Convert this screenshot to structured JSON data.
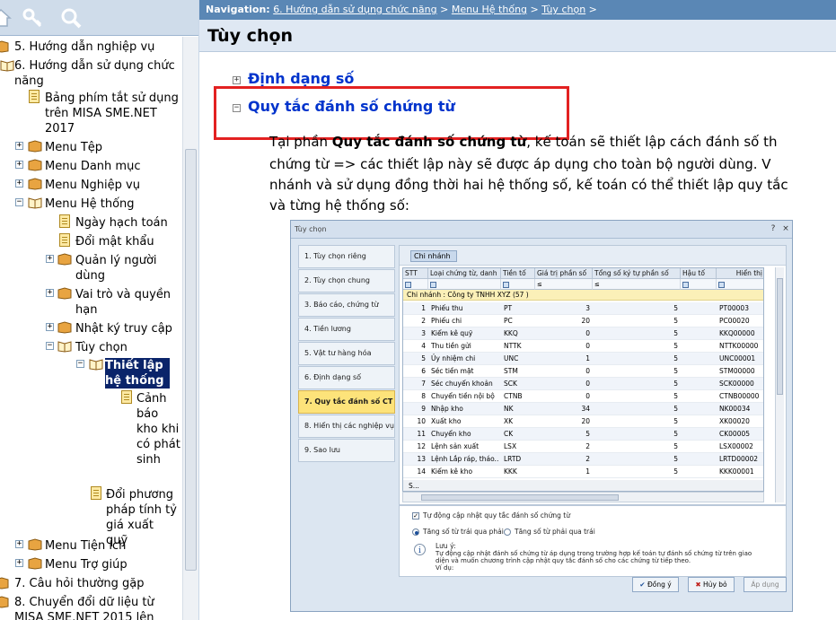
{
  "tree": {
    "items": [
      {
        "label": "5. Hướng dẫn nghiệp vụ"
      },
      {
        "label": "6. Hướng dẫn sử dụng chức năng"
      },
      {
        "label": "Bảng phím tắt sử dụng trên MISA SME.NET 2017"
      },
      {
        "label": "Menu Tệp"
      },
      {
        "label": "Menu Danh mục"
      },
      {
        "label": "Menu Nghiệp vụ"
      },
      {
        "label": "Menu Hệ thống"
      },
      {
        "label": "Ngày hạch toán"
      },
      {
        "label": "Đổi mật khẩu"
      },
      {
        "label": "Quản lý người dùng"
      },
      {
        "label": "Vai trò và quyền hạn"
      },
      {
        "label": "Nhật ký truy cập"
      },
      {
        "label": "Tùy chọn"
      },
      {
        "label": "Thiết lập hệ thống"
      },
      {
        "label": "Cảnh báo kho khi có phát sinh"
      },
      {
        "label": "Đổi phương pháp tính tỷ giá xuất quỹ"
      },
      {
        "label": "Menu Tiện ích"
      },
      {
        "label": "Menu Trợ giúp"
      },
      {
        "label": "7. Câu hỏi thường gặp"
      },
      {
        "label": "8. Chuyển đổi dữ liệu từ MISA SME.NET 2015 lên MISA"
      }
    ]
  },
  "nav": {
    "prefix": "Navigation:",
    "crumb1": "6. Hướng dẫn sử dụng chức năng",
    "sep1": " > ",
    "crumb2": "Menu Hệ thống",
    "sep2": " > ",
    "crumb3": "Tùy chọn",
    "sep3": " >"
  },
  "page": {
    "title": "Tùy chọn",
    "section1": "Định dạng số",
    "section2": "Quy tắc đánh số chứng từ",
    "para_line1_a": "Tại phần ",
    "para_line1_b": "Quy tắc đánh số chứng từ",
    "para_line1_c": ", kế toán sẽ thiết lập cách đánh số th",
    "para_line2": "chứng từ => các thiết lập này sẽ được áp dụng cho toàn bộ người dùng. V",
    "para_line3": "nhánh và sử dụng đồng thời hai hệ thống số, kế toán có thể thiết lập quy tắc",
    "para_line4": "và từng hệ thống số:"
  },
  "dialog": {
    "title": "Tùy chọn",
    "help": "?",
    "close": "×",
    "menu": [
      "1. Tùy chọn riêng",
      "2. Tùy chọn chung",
      "3. Báo cáo, chứng từ",
      "4. Tiền lương",
      "5. Vật tư hàng hóa",
      "6. Định dạng số",
      "7. Quy tắc đánh số CT",
      "8. Hiển thị các nghiệp vụ",
      "9. Sao lưu"
    ],
    "group_chip": "Chi nhánh",
    "columns": [
      "STT",
      "Loại chứng từ, danh",
      "Tiền tố",
      "Giá trị phần số",
      "Tổng số ký tự phần số",
      "Hậu tố",
      "Hiển thị"
    ],
    "filter_ops": [
      "≤",
      "≤"
    ],
    "group_row": "Chi nhánh : Công ty TNHH XYZ (57 )",
    "rows": [
      [
        "1",
        "Phiếu thu",
        "PT",
        "3",
        "5",
        "PT00003"
      ],
      [
        "2",
        "Phiếu chi",
        "PC",
        "20",
        "5",
        "PC00020"
      ],
      [
        "3",
        "Kiểm kê quỹ",
        "KKQ",
        "0",
        "5",
        "KKQ00000"
      ],
      [
        "4",
        "Thu tiền gửi",
        "NTTK",
        "0",
        "5",
        "NTTK00000"
      ],
      [
        "5",
        "Ủy nhiệm chi",
        "UNC",
        "1",
        "5",
        "UNC00001"
      ],
      [
        "6",
        "Séc tiền mặt",
        "STM",
        "0",
        "5",
        "STM00000"
      ],
      [
        "7",
        "Séc chuyển khoản",
        "SCK",
        "0",
        "5",
        "SCK00000"
      ],
      [
        "8",
        "Chuyển tiền nội bộ",
        "CTNB",
        "0",
        "5",
        "CTNB00000"
      ],
      [
        "9",
        "Nhập kho",
        "NK",
        "34",
        "5",
        "NK00034"
      ],
      [
        "10",
        "Xuất kho",
        "XK",
        "20",
        "5",
        "XK00020"
      ],
      [
        "11",
        "Chuyển kho",
        "CK",
        "5",
        "5",
        "CK00005"
      ],
      [
        "12",
        "Lệnh sản xuất",
        "LSX",
        "2",
        "5",
        "LSX00002"
      ],
      [
        "13",
        "Lệnh Lắp ráp, tháo...",
        "LRTD",
        "2",
        "5",
        "LRTD00002"
      ],
      [
        "14",
        "Kiểm kê kho",
        "KKK",
        "1",
        "5",
        "KKK00001"
      ]
    ],
    "footer_row": "S...",
    "auto_update": "Tự động cập nhật quy tắc đánh số chứng từ",
    "radio1": "Tăng số từ trái qua phải",
    "radio2": "Tăng số từ phải qua trái",
    "note_title": "Lưu ý:",
    "note_line1": "Tự động cập nhật đánh số chứng từ áp dụng trong trường hợp kế toán tự đánh số chứng từ trên giao",
    "note_line2": "diện và muốn chương trình cập nhật quy tắc đánh số cho các chứng từ tiếp theo.",
    "note_line3": "Ví dụ:",
    "btn_ok": "Đồng ý",
    "btn_cancel": "Hủy bỏ",
    "btn_apply": "Áp dụng"
  },
  "colors": {
    "nav_bg": "#5a87b5",
    "title_bg": "#dfe8f3",
    "section_link": "#0033cc",
    "highlight_box": "#e32121",
    "selected_tree": "#0a246a",
    "active_menu": "#fde37a"
  }
}
